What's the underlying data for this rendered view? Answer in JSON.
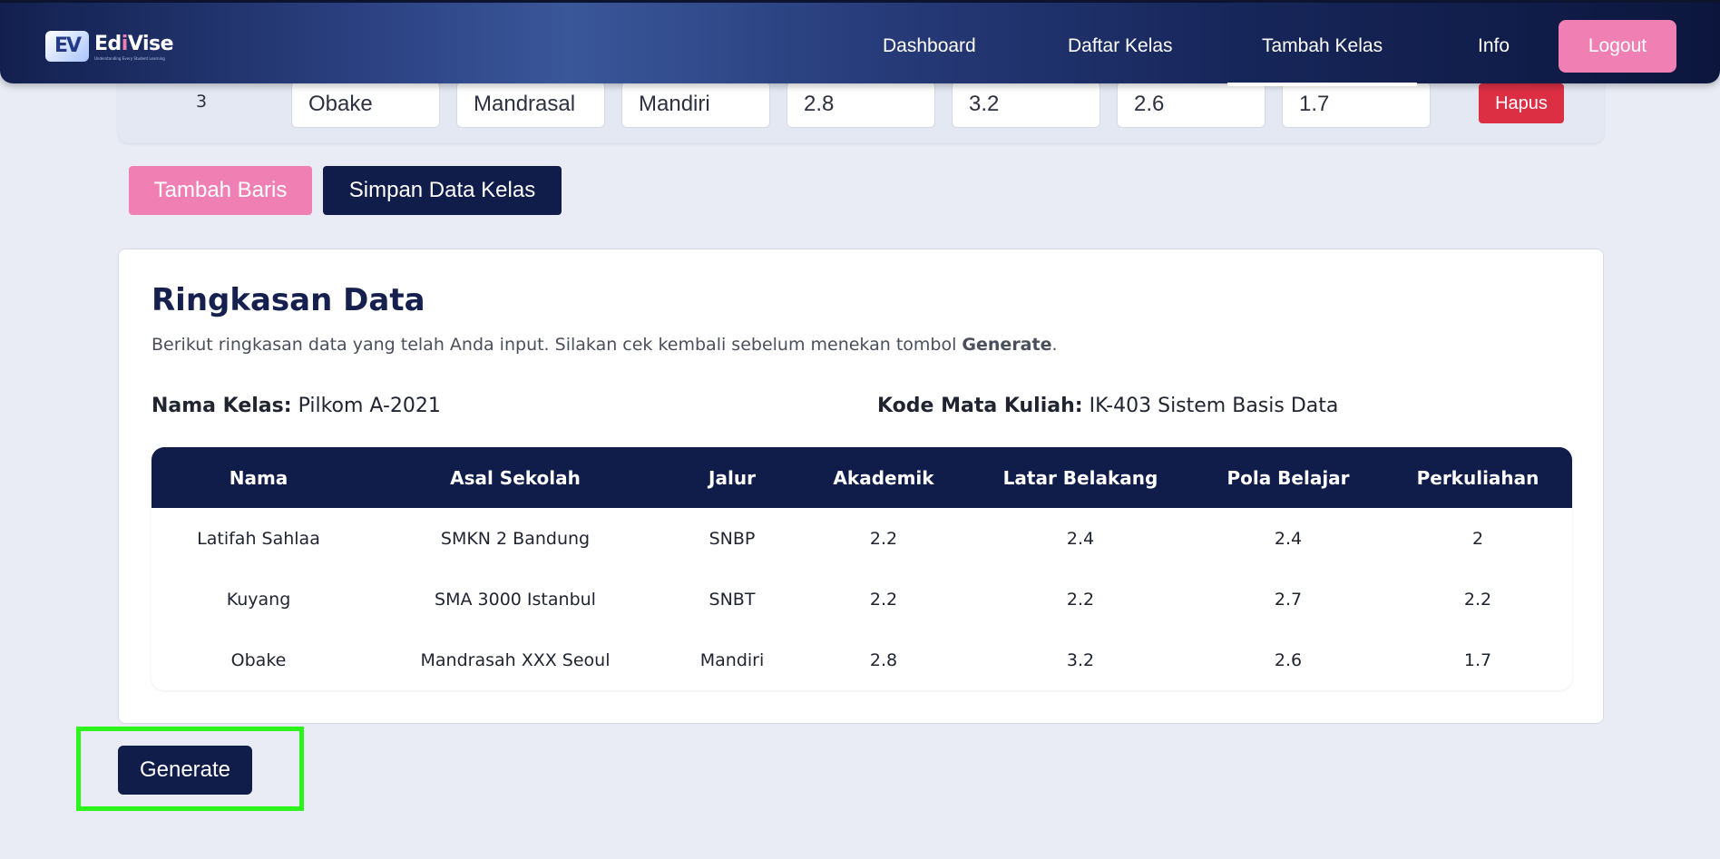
{
  "navbar": {
    "logo_mark": "EV",
    "logo_name_part1": "Ed",
    "logo_name_accent": "i",
    "logo_name_part2": "Vise",
    "logo_tagline": "Understanding Every Student Learning",
    "items": [
      {
        "label": "Dashboard"
      },
      {
        "label": "Daftar Kelas"
      },
      {
        "label": "Tambah Kelas"
      },
      {
        "label": "Info"
      }
    ],
    "active_item": "Tambah Kelas",
    "logout_label": "Logout"
  },
  "input_row": {
    "number": "3",
    "values": [
      "Obake",
      "Mandrasal",
      "Mandiri",
      "2.8",
      "3.2",
      "2.6",
      "1.7"
    ],
    "delete_label": "Hapus"
  },
  "actions": {
    "add_row_label": "Tambah Baris",
    "save_label": "Simpan Data Kelas"
  },
  "summary": {
    "title": "Ringkasan Data",
    "description_prefix": "Berikut ringkasan data yang telah Anda input. Silakan cek kembali sebelum menekan tombol ",
    "description_bold": "Generate",
    "description_suffix": ".",
    "class_name_label": "Nama Kelas:",
    "class_name_value": "Pilkom A-2021",
    "course_code_label": "Kode Mata Kuliah:",
    "course_code_value": "IK-403 Sistem Basis Data",
    "columns": [
      "Nama",
      "Asal Sekolah",
      "Jalur",
      "Akademik",
      "Latar Belakang",
      "Pola Belajar",
      "Perkuliahan"
    ],
    "rows": [
      [
        "Latifah Sahlaa",
        "SMKN 2 Bandung",
        "SNBP",
        "2.2",
        "2.4",
        "2.4",
        "2"
      ],
      [
        "Kuyang",
        "SMA 3000 Istanbul",
        "SNBT",
        "2.2",
        "2.2",
        "2.7",
        "2.2"
      ],
      [
        "Obake",
        "Mandrasah XXX Seoul",
        "Mandiri",
        "2.8",
        "3.2",
        "2.6",
        "1.7"
      ]
    ]
  },
  "generate_label": "Generate",
  "colors": {
    "navy": "#101c4a",
    "pink": "#f080b4",
    "danger": "#dc2f44",
    "highlight": "#2bf51b",
    "page_bg": "#e9ecf5"
  }
}
